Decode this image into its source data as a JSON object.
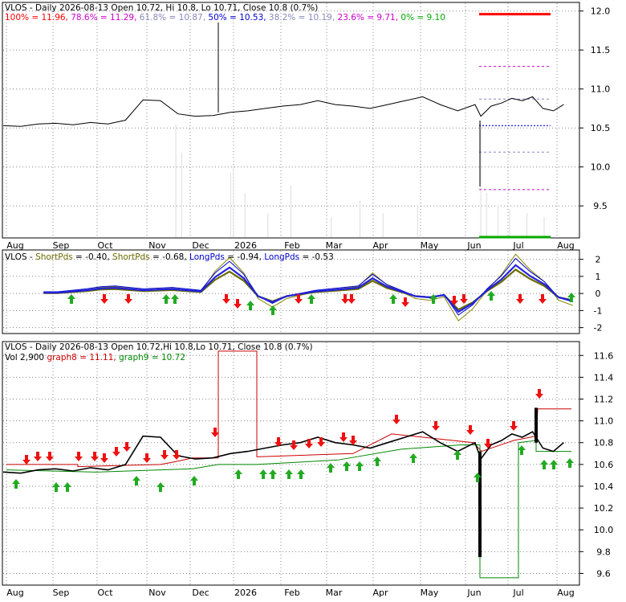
{
  "months": [
    "Aug",
    "Sep",
    "Oct",
    "Nov",
    "Dec",
    "2026",
    "Feb",
    "Mar",
    "Apr",
    "May",
    "Jun",
    "Jul",
    "Aug"
  ],
  "panel1": {
    "title": "VLOS - Daily 2026-08-13 Open 10.72, Hi 10.8, Lo 10.71, Close 10.8 (0.7%)",
    "fib_legend": [
      {
        "text": "100% = 11.96,",
        "color": "#ff0000"
      },
      {
        "text": "78.6% = 11.29,",
        "color": "#cc00cc"
      },
      {
        "text": "61.8% = 10.87,",
        "color": "#8888bb"
      },
      {
        "text": "50% = 10.53,",
        "color": "#0000cc"
      },
      {
        "text": "38.2% = 10.19,",
        "color": "#8888bb"
      },
      {
        "text": "23.6% = 9.71,",
        "color": "#cc00cc"
      },
      {
        "text": "0% = 9.10",
        "color": "#00aa00"
      }
    ],
    "yticks": [
      "12.0",
      "11.5",
      "11.0",
      "10.5",
      "10.0",
      "9.5"
    ]
  },
  "panel2": {
    "title": "VLOS - ShortPds = -0.40, ShortPds = -0.68, LongPds = -0.94, LongPds = -0.53",
    "title_parts": [
      {
        "text": "VLOS - ",
        "color": "#000000"
      },
      {
        "text": "ShortPds",
        "color": "#6b6b00"
      },
      {
        "text": " = -0.40, ",
        "color": "#000000"
      },
      {
        "text": "ShortPds",
        "color": "#6b6b00"
      },
      {
        "text": " = -0.68, ",
        "color": "#000000"
      },
      {
        "text": "LongPds",
        "color": "#0000cc"
      },
      {
        "text": " = -0.94, ",
        "color": "#000000"
      },
      {
        "text": "LongPds",
        "color": "#0000cc"
      },
      {
        "text": " = -0.53",
        "color": "#000000"
      }
    ],
    "yticks": [
      "2",
      "1",
      "0",
      "-1",
      "-2"
    ]
  },
  "panel3": {
    "title": "VLOS - Daily 2026-08-13 Open 10.72,Hi 10.8,Lo 10.71, Close 10.8 (0.7%)",
    "legend": [
      {
        "text": "Vol 2,900",
        "color": "#000000"
      },
      {
        "text": "graph8 = 11.11,",
        "color": "#cc0000"
      },
      {
        "text": "graph9 = 10.72",
        "color": "#008800"
      }
    ],
    "yticks": [
      "11.6",
      "11.4",
      "11.2",
      "11.0",
      "10.8",
      "10.6",
      "10.4",
      "10.2",
      "10.0",
      "9.8",
      "9.6"
    ]
  },
  "colors": {
    "up_arrow": "#22aa22",
    "down_arrow": "#ee1111",
    "fib_red": "#ff0000",
    "fib_magenta": "#cc00cc",
    "fib_blue": "#0000cc",
    "fib_grey": "#8888bb",
    "fib_green": "#00aa00",
    "graph8": "#cc0000",
    "graph9": "#008800"
  },
  "chart_data": [
    {
      "type": "line",
      "subtype": "ohlc-price",
      "title": "VLOS - Daily 2026-08-13 Open 10.72, Hi 10.8, Lo 10.71, Close 10.8 (0.7%)",
      "ylim": [
        9.1,
        12.1
      ],
      "x": [
        "Aug",
        "Sep",
        "Oct",
        "Nov",
        "Dec",
        "2026",
        "Feb",
        "Mar",
        "Apr",
        "May",
        "Jun",
        "Jul",
        "Aug"
      ],
      "series": [
        {
          "values": [
            10.53,
            10.52,
            10.55,
            10.56,
            10.54,
            10.57,
            10.55,
            10.6,
            10.86,
            10.85,
            10.68,
            10.65,
            10.66,
            10.7,
            10.72,
            10.75,
            10.78,
            10.8,
            10.85,
            10.8,
            10.78,
            10.75,
            10.8,
            10.85,
            10.9,
            10.8,
            10.72,
            10.8
          ]
        }
      ],
      "fib_levels": [
        {
          "label": "100%",
          "value": 11.96
        },
        {
          "label": "78.6%",
          "value": 11.29
        },
        {
          "label": "61.8%",
          "value": 10.87
        },
        {
          "label": "50%",
          "value": 10.53
        },
        {
          "label": "38.2%",
          "value": 10.19
        },
        {
          "label": "23.6%",
          "value": 9.71
        },
        {
          "label": "0%",
          "value": 9.1
        }
      ]
    },
    {
      "type": "line",
      "subtype": "oscillator",
      "title": "VLOS - ShortPds = -0.40, ShortPds = -0.68, LongPds = -0.94, LongPds = -0.53",
      "ylim": [
        -2,
        2
      ],
      "series": [
        {
          "name": "ShortPds",
          "value": -0.4
        },
        {
          "name": "ShortPds",
          "value": -0.68
        },
        {
          "name": "LongPds",
          "value": -0.94
        },
        {
          "name": "LongPds",
          "value": -0.53
        }
      ]
    },
    {
      "type": "line",
      "subtype": "ohlc-price",
      "title": "VLOS - Daily 2026-08-13 Open 10.72,Hi 10.8,Lo 10.71, Close 10.8 (0.7%)",
      "ylim": [
        9.5,
        11.7
      ],
      "series": [
        {
          "name": "graph8",
          "value": 11.11
        },
        {
          "name": "graph9",
          "value": 10.72
        }
      ],
      "volume": 2900
    }
  ]
}
